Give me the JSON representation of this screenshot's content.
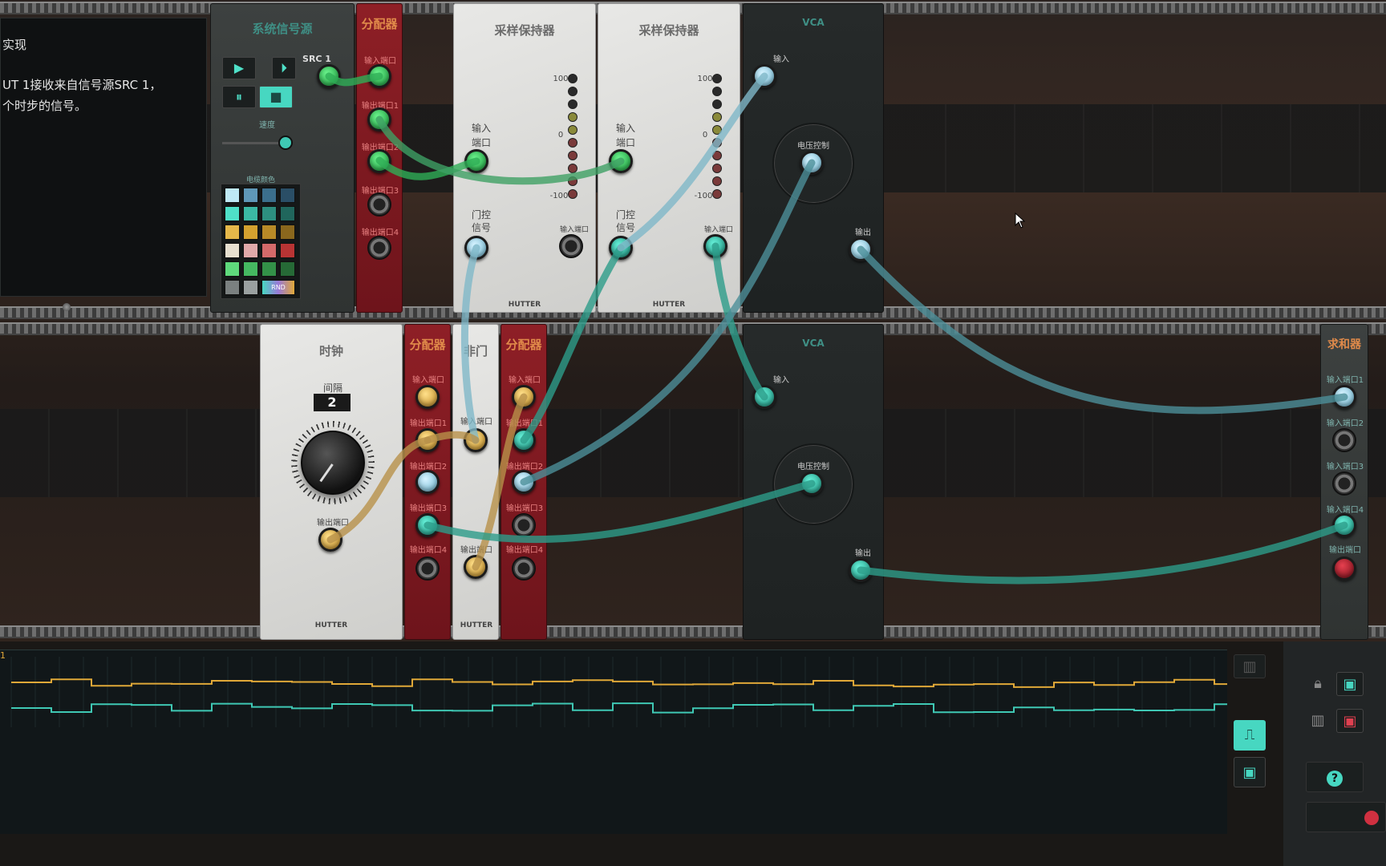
{
  "tutorial": {
    "line1": "实现",
    "line2": "UT 1接收来自信号源SRC 1，",
    "line3": "个时步的信号。"
  },
  "system_source": {
    "title": "系统信号源",
    "src_label": "SRC 1",
    "play": "▶",
    "step": "⏵",
    "pause": "⏸",
    "stop": "■",
    "speed_label": "速度",
    "cable_color_label": "电缆颜色",
    "rnd_label": "RND"
  },
  "splitter": {
    "title": "分配器",
    "in": "输入端口",
    "out1": "输出端口1",
    "out2": "输出端口2",
    "out3": "输出端口3",
    "out4": "输出端口4"
  },
  "sample_hold": {
    "title": "采样保持器",
    "in_label_1": "输入",
    "in_label_2": "端口",
    "gate_label_1": "门控",
    "gate_label_2": "信号",
    "out_label": "输入端口",
    "scale_top": "100",
    "scale_mid": "0",
    "scale_bot": "-100",
    "brand": "HUTTER"
  },
  "vca": {
    "title": "VCA",
    "in": "输入",
    "cv": "电压控制",
    "out": "输出"
  },
  "clock": {
    "title": "时钟",
    "interval_label": "间隔",
    "interval_value": "2",
    "out_label": "输出端口",
    "brand": "HUTTER"
  },
  "not_gate": {
    "title": "非门",
    "in_label": "输入端口",
    "out_label": "输出端口",
    "brand": "HUTTER"
  },
  "summer": {
    "title": "求和器",
    "in1": "输入端口1",
    "in2": "输入端口2",
    "in3": "输入端口3",
    "in4": "输入端口4",
    "out": "输出端口"
  },
  "scope": {
    "ch_a": "1",
    "ch_b": "1",
    "colors": {
      "trace_a": "#e0a838",
      "trace_b": "#3fc8b4"
    }
  },
  "icons": {
    "help": "?",
    "lock": "lock-icon",
    "trash": "trash-icon"
  }
}
